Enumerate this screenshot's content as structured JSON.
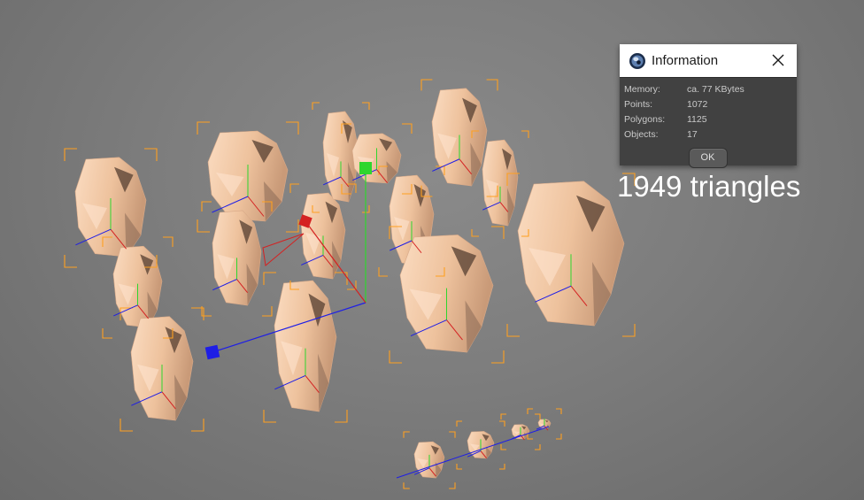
{
  "dialog": {
    "title": "Information",
    "rows": [
      {
        "label": "Memory:",
        "value": "ca. 77 KBytes"
      },
      {
        "label": "Points:",
        "value": "1072"
      },
      {
        "label": "Polygons:",
        "value": "1125"
      },
      {
        "label": "Objects:",
        "value": "17"
      }
    ],
    "ok_label": "OK"
  },
  "caption": "1949 triangles",
  "colors": {
    "viewport_bg": "#7d7d7d",
    "stone_light": "#f2c6a4",
    "stone_dark": "#5e4637",
    "bracket": "#ffa020",
    "axis_x": "#d42222",
    "axis_y": "#2ed62e",
    "axis_z": "#1e1ee6"
  },
  "icons": {
    "app": "cinema4d-logo-icon",
    "close": "close-icon"
  }
}
